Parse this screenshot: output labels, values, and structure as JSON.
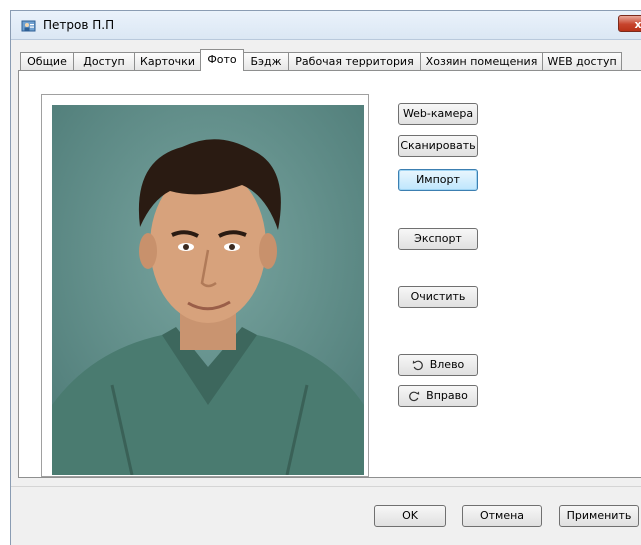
{
  "window": {
    "title": "Петров П.П",
    "close_glyph": "x"
  },
  "tabs": [
    {
      "label": "Общие",
      "active": false
    },
    {
      "label": "Доступ",
      "active": false
    },
    {
      "label": "Карточки",
      "active": false
    },
    {
      "label": "Фото",
      "active": true
    },
    {
      "label": "Бэдж",
      "active": false
    },
    {
      "label": "Рабочая территория",
      "active": false
    },
    {
      "label": "Хозяин помещения",
      "active": false
    },
    {
      "label": "WEB доступ",
      "active": false
    }
  ],
  "photo_actions": {
    "webcam": "Web-камера",
    "scan": "Сканировать",
    "import": "Импорт",
    "export": "Экспорт",
    "clear": "Очистить",
    "rotate_left": "Влево",
    "rotate_right": "Вправо"
  },
  "footer": {
    "ok": "OK",
    "cancel": "Отмена",
    "apply": "Применить"
  },
  "icons": {
    "app": "user-card-icon",
    "rotate_left": "rotate-left-icon",
    "rotate_right": "rotate-right-icon",
    "close": "close-icon"
  },
  "colors": {
    "titlebar": "#dbe7f4",
    "close": "#c7442d",
    "photo_bg": "#5f8e8a",
    "shirt": "#4d7c72"
  }
}
